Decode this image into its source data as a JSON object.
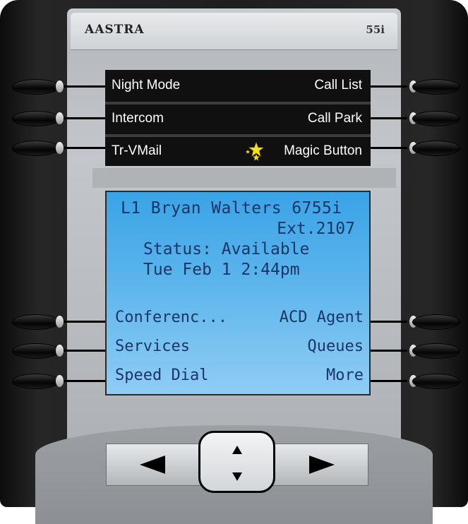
{
  "header": {
    "brand": "AASTRA",
    "model": "55i"
  },
  "programmable_keys": [
    {
      "left": "Night Mode",
      "right": "Call List"
    },
    {
      "left": "Intercom",
      "right": "Call Park"
    },
    {
      "left": "Tr-VMail",
      "right": "Magic Button"
    }
  ],
  "lcd": {
    "line_name": "L1 Bryan Walters 6755i",
    "extension": "Ext.2107",
    "status": "Status: Available",
    "datetime": "Tue Feb 1 2:44pm",
    "softkeys": [
      {
        "left": "Conferenc...",
        "right": "ACD Agent"
      },
      {
        "left": "Services",
        "right": "Queues"
      },
      {
        "left": "Speed Dial",
        "right": "More"
      }
    ]
  },
  "icons": {
    "magic": "star-icon",
    "nav_left": "triangle-left-icon",
    "nav_right": "triangle-right-icon",
    "nav_up": "triangle-up-icon",
    "nav_down": "triangle-down-icon"
  },
  "colors": {
    "lcd_top": "#3aa3e6",
    "lcd_bottom": "#8fcdf4",
    "lcd_text": "#1b3566",
    "star": "#f7e317"
  }
}
